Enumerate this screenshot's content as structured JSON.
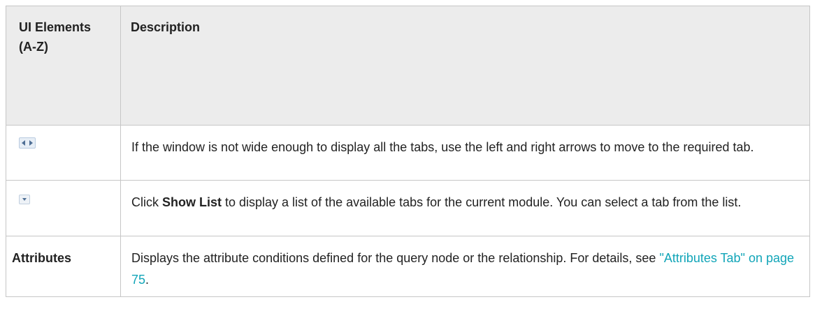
{
  "table": {
    "headers": {
      "ui_elements": "UI Elements (A-Z)",
      "description": "Description"
    },
    "rows": [
      {
        "ui_icon": "left-right-arrows-icon",
        "description": "If the window is not wide enough to display all the tabs, use the left and right arrows to move to the required tab."
      },
      {
        "ui_icon": "dropdown-arrow-icon",
        "description_pre": "Click ",
        "description_bold": "Show List",
        "description_post": " to display a list of the available tabs for the current module. You can select a tab from the list."
      },
      {
        "ui_label": "Attributes",
        "description_pre": "Displays the attribute conditions defined for the query node or the relationship. For details, see ",
        "description_link": "\"Attributes Tab\" on page 75",
        "description_post": "."
      }
    ]
  },
  "colors": {
    "header_bg": "#ececec",
    "border": "#c6c6c6",
    "link": "#11a5b8",
    "text": "#222222"
  }
}
